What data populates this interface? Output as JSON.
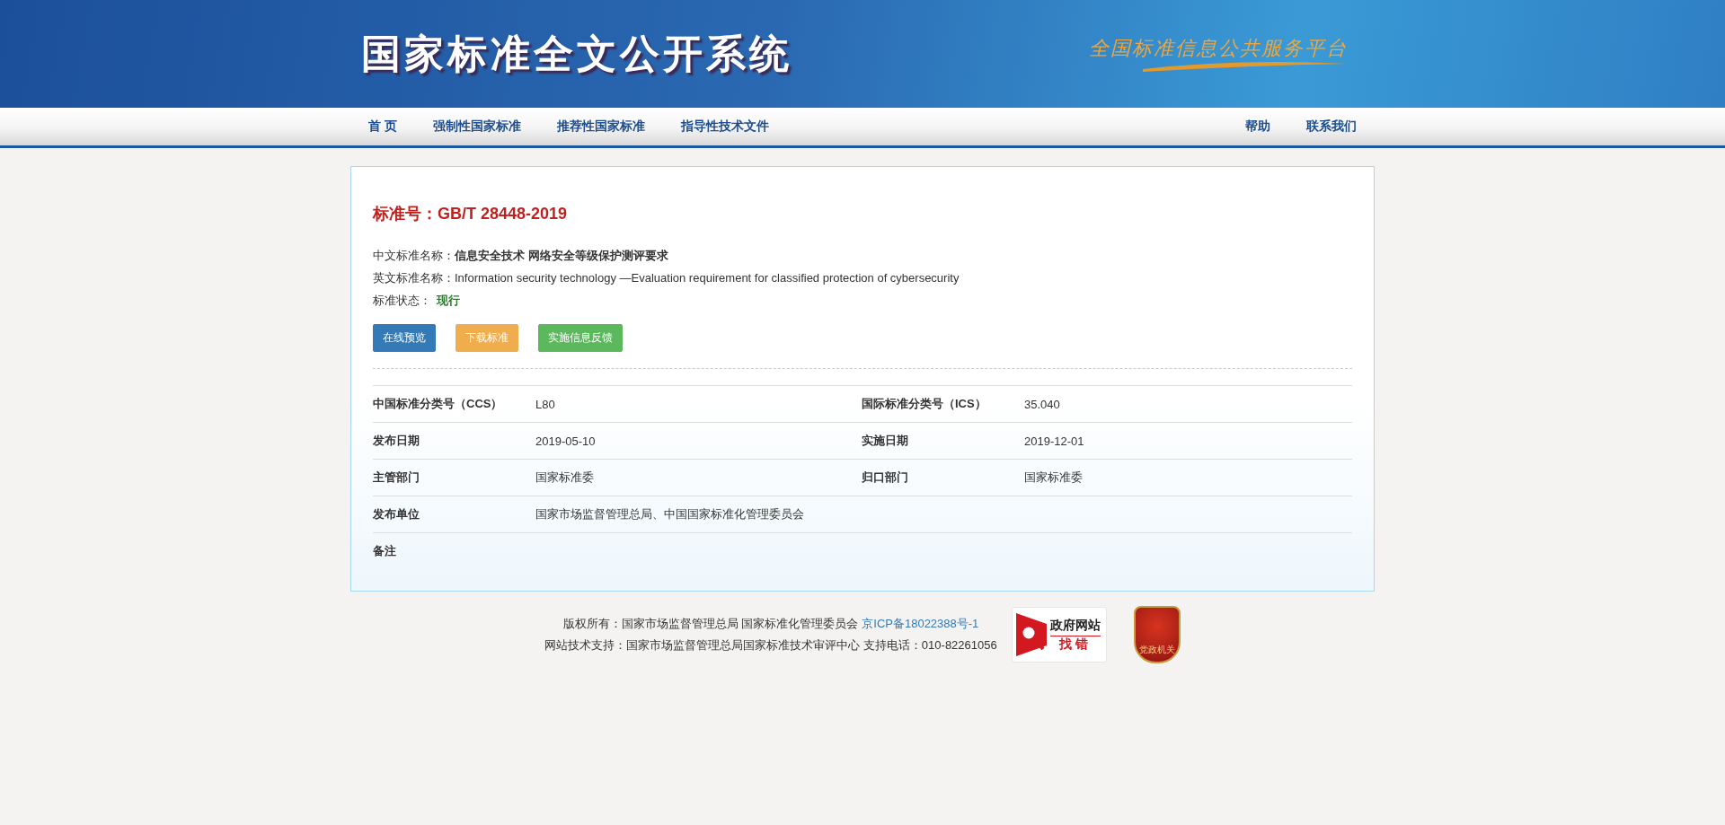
{
  "header": {
    "title": "国家标准全文公开系统",
    "slogan": "全国标准信息公共服务平台"
  },
  "nav": {
    "left": [
      "首 页",
      "强制性国家标准",
      "推荐性国家标准",
      "指导性技术文件"
    ],
    "right": [
      "帮助",
      "联系我们"
    ]
  },
  "standard": {
    "number_label": "标准号：",
    "number": "GB/T 28448-2019",
    "info": [
      {
        "label": "中文标准名称：",
        "value": "信息安全技术 网络安全等级保护测评要求",
        "kind": "bold"
      },
      {
        "label": "英文标准名称：",
        "value": "Information security technology —Evaluation requirement for classified protection of cybersecurity",
        "kind": "plain"
      },
      {
        "label": "标准状态：",
        "value": "现行",
        "kind": "status"
      }
    ],
    "buttons": [
      {
        "label": "在线预览",
        "color": "#337ab7"
      },
      {
        "label": "下载标准",
        "color": "#f0ad4e"
      },
      {
        "label": "实施信息反馈",
        "color": "#5cb85c"
      }
    ],
    "details": [
      [
        {
          "label": "中国标准分类号（CCS）",
          "value": "L80"
        },
        {
          "label": "国际标准分类号（ICS）",
          "value": "35.040"
        }
      ],
      [
        {
          "label": "发布日期",
          "value": "2019-05-10"
        },
        {
          "label": "实施日期",
          "value": "2019-12-01"
        }
      ],
      [
        {
          "label": "主管部门",
          "value": "国家标准委"
        },
        {
          "label": "归口部门",
          "value": "国家标准委"
        }
      ],
      [
        {
          "label": "发布单位",
          "value": "国家市场监督管理总局、中国国家标准化管理委员会"
        }
      ],
      [
        {
          "label": "备注"
        }
      ]
    ]
  },
  "footer": {
    "copyright": "版权所有：国家市场监督管理总局 国家标准化管理委员会",
    "icp_link": "京ICP备18022388号-1",
    "support": "网站技术支持：国家市场监督管理总局国家标准技术审评中心 支持电话：010-82261056",
    "badge_title": "政府网站",
    "badge_action": "找错",
    "emblem_text": "党政机关"
  }
}
